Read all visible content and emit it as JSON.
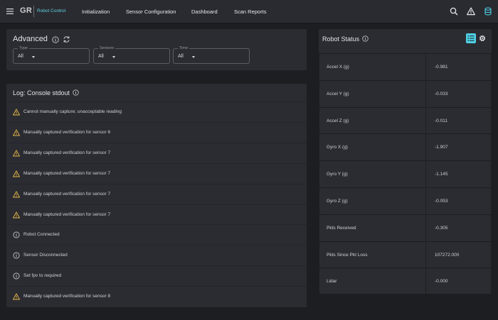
{
  "app": {
    "logo": "GR",
    "subtitle": "Robot Control",
    "nav": [
      "Initialization",
      "Sensor Configuration",
      "Dashboard",
      "Scan Reports"
    ],
    "icons": [
      "menu-icon",
      "search-icon",
      "warning-icon",
      "database-icon"
    ],
    "accent_color": "#4fd1e5"
  },
  "advanced": {
    "title": "Advanced",
    "filters": [
      {
        "label": "Type",
        "value": "All"
      },
      {
        "label": "Sensors",
        "value": "All"
      },
      {
        "label": "Time",
        "value": "All"
      }
    ]
  },
  "log": {
    "title": "Log: Console stdout",
    "entries": [
      {
        "level": "warning",
        "text": "Cannot manually capture; unacceptable reading"
      },
      {
        "level": "warning",
        "text": "Manually captured verification for sensor 6"
      },
      {
        "level": "warning",
        "text": "Manually captured verification for sensor 7"
      },
      {
        "level": "warning",
        "text": "Manually captured verification for sensor 7"
      },
      {
        "level": "warning",
        "text": "Manually captured verification for sensor 7"
      },
      {
        "level": "warning",
        "text": "Manually captured verification for sensor 7"
      },
      {
        "level": "info",
        "text": "Robot Connected"
      },
      {
        "level": "info",
        "text": "Sensor Disconnected"
      },
      {
        "level": "info",
        "text": "Set fpv to required"
      },
      {
        "level": "warning",
        "text": "Manually captured verification for sensor 8"
      }
    ],
    "warning_color": "#e6b84a"
  },
  "robot_status": {
    "title": "Robot Status",
    "rows": [
      {
        "label": "Accel X (g)",
        "value": "-0.981"
      },
      {
        "label": "Accel Y (g)",
        "value": "-0.033"
      },
      {
        "label": "Accel Z (g)",
        "value": "-0.011"
      },
      {
        "label": "Gyro X (g)",
        "value": "-1.907"
      },
      {
        "label": "Gyro Y (g)",
        "value": "-1.145"
      },
      {
        "label": "Gyro Z (g)",
        "value": "-0.053"
      },
      {
        "label": "Pkts Received",
        "value": "-0.305"
      },
      {
        "label": "Pkts Since Pkt Loss",
        "value": "107272.000"
      },
      {
        "label": "Lidar",
        "value": "-0.000"
      }
    ]
  }
}
